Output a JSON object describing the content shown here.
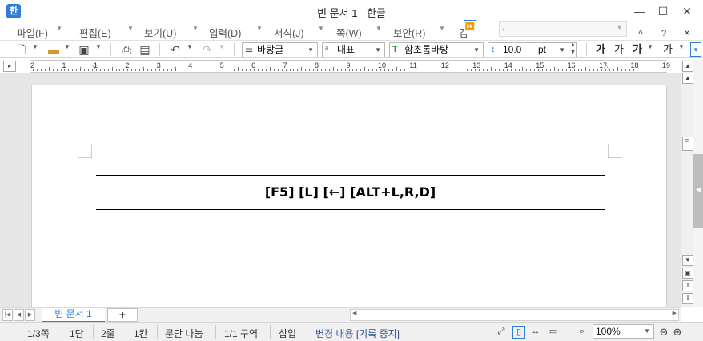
{
  "window": {
    "title": "빈 문서 1 - 한글",
    "app_icon_label": "한",
    "controls": {
      "minimize": "—",
      "maximize": "☐",
      "close": "✕"
    }
  },
  "menu": {
    "items": [
      {
        "label": "파일(F)"
      },
      {
        "label": "편집(E)"
      },
      {
        "label": "보기(U)"
      },
      {
        "label": "입력(D)"
      },
      {
        "label": "서식(J)"
      },
      {
        "label": "쪽(W)"
      },
      {
        "label": "보안(R)"
      },
      {
        "label": "검"
      }
    ],
    "more_icon": "⏩",
    "search_value": ",",
    "ribbon_toggle": "^",
    "help": "?",
    "close_doc": "✕"
  },
  "toolbar": {
    "style_combo": "바탕글",
    "lang_combo": "대표",
    "font_combo": "함초롬바탕",
    "size_value": "10.0",
    "size_unit": "pt",
    "bold_label": "가",
    "italic_label": "가",
    "underline_label": "가",
    "strike_label": "가",
    "overflow_icon": "⋮"
  },
  "ruler": {
    "numbers": [
      "2",
      "1",
      "1",
      "2",
      "3",
      "4",
      "5",
      "6",
      "7",
      "8",
      "9",
      "10",
      "11",
      "12",
      "13",
      "14",
      "15",
      "16",
      "17",
      "18",
      "19"
    ]
  },
  "document": {
    "text": "[F5] [L] [←] [ALT+L,R,D]"
  },
  "tabs": {
    "doc_tab": "빈 문서 1",
    "add_tab": "+"
  },
  "status": {
    "page": "1/3쪽",
    "column": "1단",
    "line": "2줄",
    "cell": "1칸",
    "paragraph": "문단 나눔",
    "section": "1/1 구역",
    "mode": "삽입",
    "track": "변경 내용 [기록 중지]",
    "zoom": "100%"
  },
  "colors": {
    "accent": "#2f7dd7",
    "track_text": "#2a4f8f"
  }
}
